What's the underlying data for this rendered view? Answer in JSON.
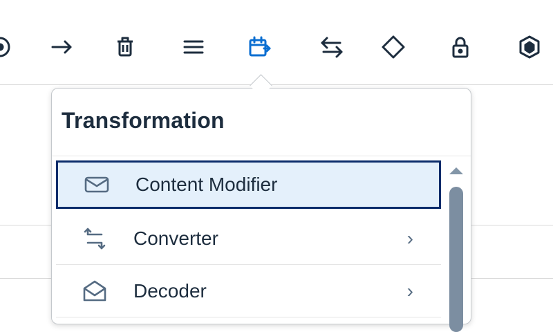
{
  "toolbar": {
    "icons": [
      "circle-partial-icon",
      "arrow-right-icon",
      "trash-icon",
      "menu-icon",
      "transformation-icon",
      "swap-icon",
      "diamond-icon",
      "lock-icon",
      "cube-icon"
    ],
    "active": "transformation-icon",
    "active_color": "#0a6ed1"
  },
  "popover": {
    "title": "Transformation",
    "items": [
      {
        "label": "Content Modifier",
        "icon": "envelope-icon",
        "selected": true,
        "has_submenu": false
      },
      {
        "label": "Converter",
        "icon": "converter-icon",
        "selected": false,
        "has_submenu": true,
        "chevron": "›"
      },
      {
        "label": "Decoder",
        "icon": "open-envelope-icon",
        "selected": false,
        "has_submenu": true,
        "chevron": "›"
      }
    ]
  },
  "colors": {
    "selected_border": "#0b2c6b",
    "selected_bg": "#e4f0fb",
    "icon_gray": "#556b82"
  }
}
